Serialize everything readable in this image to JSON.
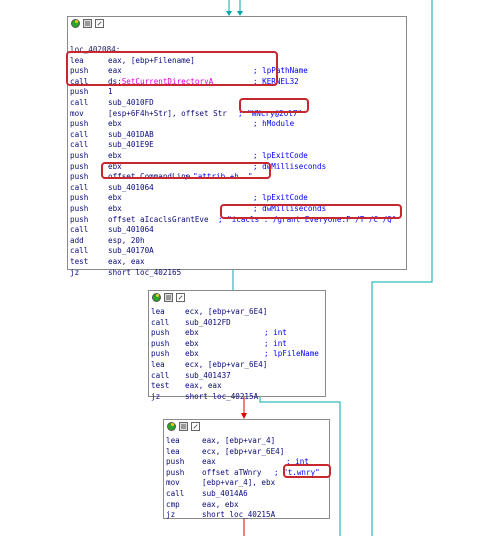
{
  "nodes": [
    {
      "lines": [
        {
          "m": "loc_402084:",
          "o": "",
          "c": ""
        },
        {
          "m": "lea",
          "o": "eax, [ebp+Filename]",
          "c": ""
        },
        {
          "m": "push",
          "o": "eax",
          "c": "; lpPathName"
        },
        {
          "m": "call",
          "o": "ds:SetCurrentDirectoryA",
          "c": "; KERNEL32"
        },
        {
          "m": "push",
          "o": "1",
          "c": ""
        },
        {
          "m": "call",
          "o": "sub_4010FD",
          "c": ""
        },
        {
          "m": "mov",
          "o": "[esp+6F4h+Str], offset Str",
          "c": "; \"WNcry@2ol7\""
        },
        {
          "m": "push",
          "o": "ebx",
          "c": "; hModule"
        },
        {
          "m": "call",
          "o": "sub_401DAB",
          "c": ""
        },
        {
          "m": "call",
          "o": "sub_401E9E",
          "c": ""
        },
        {
          "m": "push",
          "o": "ebx",
          "c": "; lpExitCode"
        },
        {
          "m": "push",
          "o": "ebx",
          "c": "; dwMilliseconds"
        },
        {
          "m": "push",
          "o": "offset CommandLine",
          "c": "; \"attrib +h .\""
        },
        {
          "m": "call",
          "o": "sub_401064",
          "c": ""
        },
        {
          "m": "push",
          "o": "ebx",
          "c": "; lpExitCode"
        },
        {
          "m": "push",
          "o": "ebx",
          "c": "; dwMilliseconds"
        },
        {
          "m": "push",
          "o": "offset aIcaclsGrantEve",
          "c": "; \"icacls . /grant Everyone:F /T /C /Q\""
        },
        {
          "m": "call",
          "o": "sub_401064",
          "c": ""
        },
        {
          "m": "add",
          "o": "esp, 20h",
          "c": ""
        },
        {
          "m": "call",
          "o": "sub_40170A",
          "c": ""
        },
        {
          "m": "test",
          "o": "eax, eax",
          "c": ""
        },
        {
          "m": "jz",
          "o": "short loc_402165",
          "c": ""
        }
      ]
    },
    {
      "lines": [
        {
          "m": "lea",
          "o": "ecx, [ebp+var_6E4]",
          "c": ""
        },
        {
          "m": "call",
          "o": "sub_4012FD",
          "c": ""
        },
        {
          "m": "push",
          "o": "ebx",
          "c": "; int"
        },
        {
          "m": "push",
          "o": "ebx",
          "c": "; int"
        },
        {
          "m": "push",
          "o": "ebx",
          "c": "; lpFileName"
        },
        {
          "m": "lea",
          "o": "ecx, [ebp+var_6E4]",
          "c": ""
        },
        {
          "m": "call",
          "o": "sub_401437",
          "c": ""
        },
        {
          "m": "test",
          "o": "eax, eax",
          "c": ""
        },
        {
          "m": "jz",
          "o": "short loc_40215A",
          "c": ""
        }
      ]
    },
    {
      "lines": [
        {
          "m": "lea",
          "o": "eax, [ebp+var_4]",
          "c": ""
        },
        {
          "m": "lea",
          "o": "ecx, [ebp+var_6E4]",
          "c": ""
        },
        {
          "m": "push",
          "o": "eax",
          "c": "; int"
        },
        {
          "m": "push",
          "o": "offset aTWnry",
          "c": "; \"t.wnry\""
        },
        {
          "m": "mov",
          "o": "[ebp+var_4], ebx",
          "c": ""
        },
        {
          "m": "call",
          "o": "sub_4014A6",
          "c": ""
        },
        {
          "m": "cmp",
          "o": "eax, ebx",
          "c": ""
        },
        {
          "m": "jz",
          "o": "short loc_40215A",
          "c": ""
        }
      ]
    }
  ],
  "colors": {
    "edge_cyan": "#00a8a8",
    "edge_red": "#e00000",
    "highlight": "#c8272f"
  }
}
